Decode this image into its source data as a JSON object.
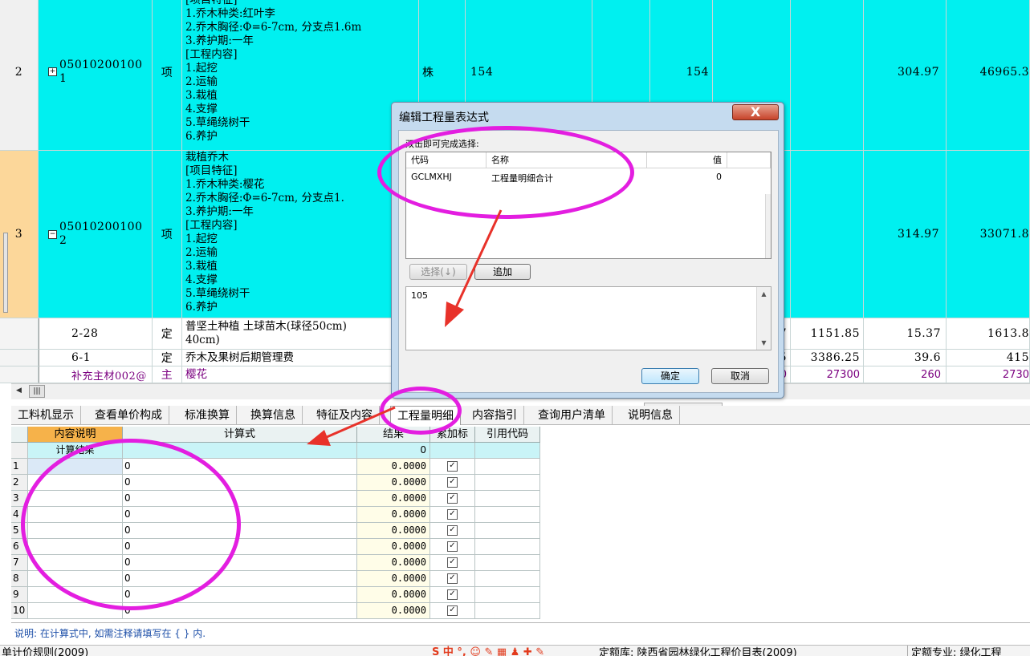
{
  "rows": [
    {
      "num": "2",
      "code_line1": "05010200100",
      "code_line2": "1",
      "expander": "+",
      "type": "项",
      "desc": "[项目特征]\n1.乔木种类:红叶李\n2.乔木胸径:Φ=6-7cm, 分支点1.6m\n3.养护期:一年\n[工程内容]\n1.起挖\n2.运输\n3.栽植\n4.支撑\n5.草绳绕树干\n6.养护",
      "unit": "株",
      "qty_expr": "154",
      "qty": "154",
      "price": "304.97",
      "total": "46965.3"
    },
    {
      "num": "3",
      "code_line1": "05010200100",
      "code_line2": "2",
      "expander": "−",
      "type": "项",
      "desc": "栽植乔木\n[项目特征]\n1.乔木种类:樱花\n2.乔木胸径:Φ=6-7cm, 分支点1.\n3.养护期:一年\n[工程内容]\n1.起挖\n2.运输\n3.栽植\n4.支撑\n5.草绳绕树干\n6.养护",
      "price": "314.97",
      "total": "33071.8"
    }
  ],
  "subrows": [
    {
      "code": "2-28",
      "type": "定",
      "desc": "普坚土种植 土球苗木(球径50cm)\n40cm)",
      "c1": "7",
      "c2": "1151.85",
      "c3": "15.37",
      "c4": "1613.8"
    },
    {
      "code": "6-1",
      "type": "定",
      "desc": "乔木及果树后期管理费",
      "c1": "5",
      "c2": "3386.25",
      "c3": "39.6",
      "c4": "415"
    },
    {
      "code": "补充主材002@",
      "type": "主",
      "desc": "樱花",
      "c1": "0",
      "c2": "27300",
      "c3": "260",
      "c4": "2730"
    }
  ],
  "tabs": [
    "工料机显示",
    "查看单价构成",
    "标准换算",
    "换算信息",
    "特征及内容",
    "工程量明细",
    "内容指引",
    "查询用户清单",
    "说明信息"
  ],
  "detail": {
    "headers": [
      "内容说明",
      "计算式",
      "结果",
      "累加标",
      "引用代码"
    ],
    "summary_label": "计算结果",
    "summary_value": "0",
    "rows": [
      {
        "n": "1",
        "expr": "0",
        "result": "0.0000",
        "checked": "✓"
      },
      {
        "n": "2",
        "expr": "0",
        "result": "0.0000",
        "checked": "✓"
      },
      {
        "n": "3",
        "expr": "0",
        "result": "0.0000",
        "checked": "✓"
      },
      {
        "n": "4",
        "expr": "0",
        "result": "0.0000",
        "checked": "✓"
      },
      {
        "n": "5",
        "expr": "0",
        "result": "0.0000",
        "checked": "✓"
      },
      {
        "n": "6",
        "expr": "0",
        "result": "0.0000",
        "checked": "✓"
      },
      {
        "n": "7",
        "expr": "0",
        "result": "0.0000",
        "checked": "✓"
      },
      {
        "n": "8",
        "expr": "0",
        "result": "0.0000",
        "checked": "✓"
      },
      {
        "n": "9",
        "expr": "0",
        "result": "0.0000",
        "checked": "✓"
      },
      {
        "n": "10",
        "expr": "0",
        "result": "0.0000",
        "checked": "✓"
      }
    ]
  },
  "hint": "说明: 在计算式中, 如需注释请填写在 { } 内.",
  "status": {
    "left": "单计价规则(2009)",
    "ime": "S 中 °, ☺ ✎ ▦ ♟ ✚ ✎",
    "quota_lib": "定额库: 陕西省园林绿化工程价目表(2009)",
    "quota_major": "定额专业: 绿化工程"
  },
  "dialog": {
    "title": "编辑工程量表达式",
    "close": "X",
    "label": "双击即可完成选择:",
    "col_code": "代码",
    "col_name": "名称",
    "col_value": "值",
    "item_code": "GCLMXHJ",
    "item_name": "工程量明细合计",
    "item_value": "0",
    "select_btn": "选择(↓)",
    "add_btn": "追加",
    "expression": "105",
    "ok": "确定",
    "cancel": "取消"
  },
  "colors": {
    "cyan": "#00f0f0",
    "annotation": "#e31ee0",
    "arrow": "#e8322a"
  }
}
